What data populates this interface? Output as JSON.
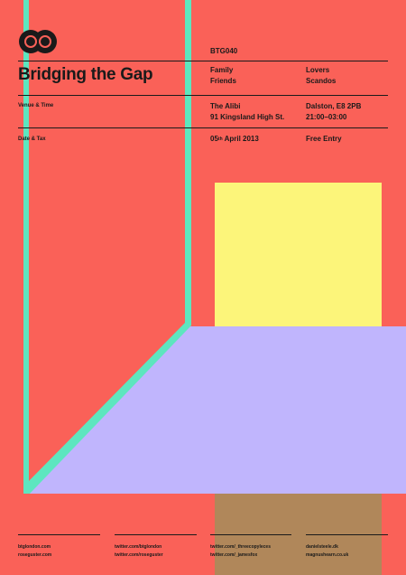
{
  "poster": {
    "code": "BTG040",
    "title": "Bridging the Gap",
    "audience": {
      "col1": [
        "Family",
        "Friends"
      ],
      "col2": [
        "Lovers",
        "Scandos"
      ]
    },
    "venue_label": "Venue & Time",
    "venue": {
      "name": "The Alibi",
      "address": "91 Kingsland High St.",
      "area": "Dalston, E8 2PB",
      "time": "21:00–03:00"
    },
    "date_label": "Date & Tax",
    "date": {
      "day": "05",
      "suffix": "th",
      "rest": "April 2013"
    },
    "entry": "Free Entry"
  },
  "footer": {
    "col1": [
      "btglondon.com",
      "roseguster.com"
    ],
    "col2": [
      "twitter.com/btglondon",
      "twitter.com/roseguster"
    ],
    "col3": [
      "twitter.com/_threecopyleces",
      "twitter.com/_jamesfox"
    ],
    "col4": [
      "danielsteele.dk",
      "magnushearn.co.uk"
    ]
  },
  "colors": {
    "background": "#fa6158",
    "mint": "#5de6bf",
    "yellow": "#fcf57a",
    "lavender": "#c0b5fd",
    "brown": "#b0875a",
    "ink": "#1a1a1a"
  }
}
